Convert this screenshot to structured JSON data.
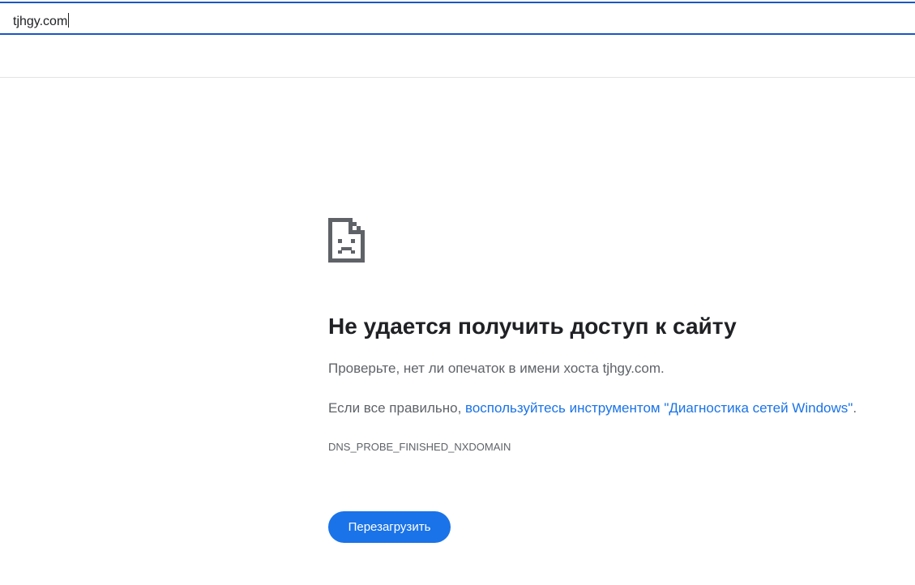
{
  "omnibox": {
    "value": "tjhgy.com"
  },
  "error": {
    "icon": "sad-page-icon",
    "title": "Не удается получить доступ к сайту",
    "hint_host": "Проверьте, нет ли опечаток в имени хоста tjhgy.com.",
    "hint_prefix": "Если все правильно, ",
    "diagnostics_link": "воспользуйтесь инструментом \"Диагностика сетей Windows\"",
    "hint_suffix": ".",
    "code": "DNS_PROBE_FINISHED_NXDOMAIN",
    "reload_label": "Перезагрузить"
  },
  "colors": {
    "omnibox_border": "#1a56c4",
    "link": "#1a73e8",
    "button": "#1a73e8",
    "title_text": "#202124",
    "body_text": "#5f6368"
  }
}
